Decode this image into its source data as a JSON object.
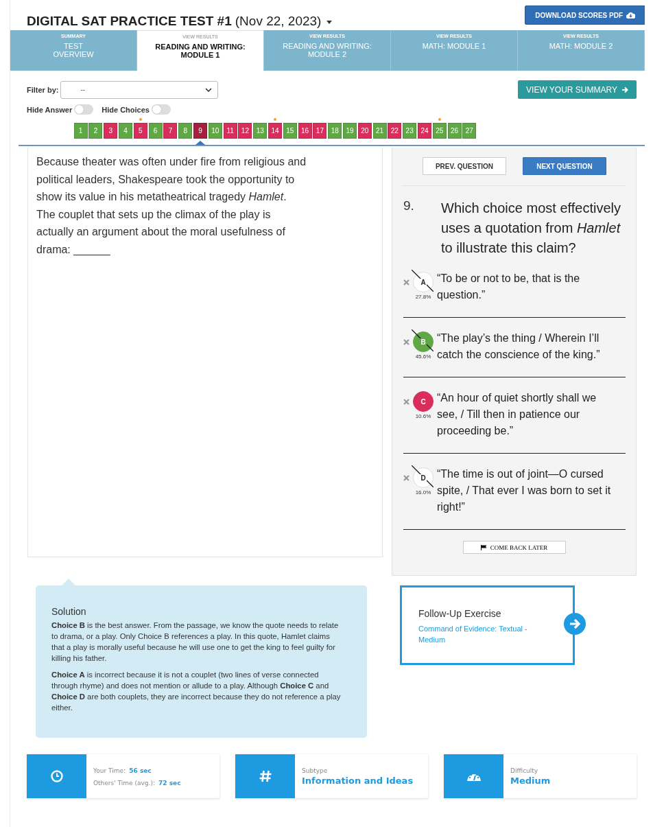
{
  "header": {
    "title": "DIGITAL SAT PRACTICE TEST #1",
    "date": "(Nov 22, 2023)",
    "download_button": "DOWNLOAD SCORES PDF"
  },
  "tabs": [
    {
      "kicker": "SUMMARY",
      "label": "TEST\nOVERVIEW",
      "selected": false
    },
    {
      "kicker": "VIEW RESULTS",
      "label": "READING AND WRITING:\nMODULE 1",
      "selected": true
    },
    {
      "kicker": "VIEW RESULTS",
      "label": "READING AND WRITING:\nMODULE 2",
      "selected": false
    },
    {
      "kicker": "VIEW RESULTS",
      "label": "MATH: MODULE 1",
      "selected": false
    },
    {
      "kicker": "VIEW RESULTS",
      "label": "MATH: MODULE 2",
      "selected": false
    }
  ],
  "filter": {
    "label": "Filter by:",
    "value": "--"
  },
  "summary_button": "VIEW YOUR SUMMARY",
  "toggles": [
    {
      "label": "Hide Answer",
      "on": false
    },
    {
      "label": "Hide Choices",
      "on": false
    }
  ],
  "questions": [
    {
      "number": "1",
      "correct": true,
      "flagged": false,
      "selected": false
    },
    {
      "number": "2",
      "correct": true,
      "flagged": false,
      "selected": false
    },
    {
      "number": "3",
      "correct": false,
      "flagged": false,
      "selected": false
    },
    {
      "number": "4",
      "correct": true,
      "flagged": false,
      "selected": false
    },
    {
      "number": "5",
      "correct": false,
      "flagged": true,
      "selected": false
    },
    {
      "number": "6",
      "correct": true,
      "flagged": false,
      "selected": false
    },
    {
      "number": "7",
      "correct": false,
      "flagged": false,
      "selected": false
    },
    {
      "number": "8",
      "correct": true,
      "flagged": false,
      "selected": false
    },
    {
      "number": "9",
      "correct": false,
      "flagged": false,
      "selected": true
    },
    {
      "number": "10",
      "correct": true,
      "flagged": false,
      "selected": false
    },
    {
      "number": "11",
      "correct": false,
      "flagged": false,
      "selected": false
    },
    {
      "number": "12",
      "correct": false,
      "flagged": false,
      "selected": false
    },
    {
      "number": "13",
      "correct": true,
      "flagged": false,
      "selected": false
    },
    {
      "number": "14",
      "correct": false,
      "flagged": true,
      "selected": false
    },
    {
      "number": "15",
      "correct": true,
      "flagged": false,
      "selected": false
    },
    {
      "number": "16",
      "correct": false,
      "flagged": false,
      "selected": false
    },
    {
      "number": "17",
      "correct": false,
      "flagged": false,
      "selected": false
    },
    {
      "number": "18",
      "correct": true,
      "flagged": false,
      "selected": false
    },
    {
      "number": "19",
      "correct": true,
      "flagged": false,
      "selected": false
    },
    {
      "number": "20",
      "correct": false,
      "flagged": false,
      "selected": false
    },
    {
      "number": "21",
      "correct": true,
      "flagged": false,
      "selected": false
    },
    {
      "number": "22",
      "correct": false,
      "flagged": false,
      "selected": false
    },
    {
      "number": "23",
      "correct": true,
      "flagged": false,
      "selected": false
    },
    {
      "number": "24",
      "correct": false,
      "flagged": false,
      "selected": false
    },
    {
      "number": "25",
      "correct": true,
      "flagged": true,
      "selected": false
    },
    {
      "number": "26",
      "correct": true,
      "flagged": false,
      "selected": false
    },
    {
      "number": "27",
      "correct": true,
      "flagged": false,
      "selected": false
    }
  ],
  "passage": {
    "text": "Because theater was often under fire from religious and political leaders, Shakespeare took the opportunity to show its value in his metatheatrical tragedy *Hamlet*. The couplet that sets up the climax of the play is actually an argument about the moral usefulness of drama: ______"
  },
  "question_panel": {
    "prev_button": "PREV. QUESTION",
    "next_button": "NEXT QUESTION",
    "number": "9.",
    "prompt": "Which choice most effectively uses a quotation from *Hamlet* to illustrate this claim?",
    "choices": [
      {
        "letter": "A",
        "text": "“To be or not to be, that is the question.”",
        "percent": "27.8%",
        "correct_answer": false,
        "chosen": false,
        "crossed_out": true
      },
      {
        "letter": "B",
        "text": "“The play’s the thing / Wherein I’ll catch the conscience of the king.”",
        "percent": "45.6%",
        "correct_answer": true,
        "chosen": false,
        "crossed_out": true
      },
      {
        "letter": "C",
        "text": "“An hour of quiet shortly shall we see, / Till then in patience our proceeding be.”",
        "percent": "10.6%",
        "correct_answer": false,
        "chosen": true,
        "crossed_out": false
      },
      {
        "letter": "D",
        "text": "“The time is out of joint—O cursed spite, / That ever I was born to set it right!”",
        "percent": "16.0%",
        "correct_answer": false,
        "chosen": false,
        "crossed_out": true
      }
    ],
    "later_button": "COME BACK LATER"
  },
  "solution": {
    "title": "Solution",
    "paragraphs": [
      "**Choice B** is the best answer. From the passage, we know the quote needs to relate to drama, or a play. Only Choice B references a play. In this quote, Hamlet claims that a play is morally useful because he will use one to get the king to feel guilty for killing his father.",
      "**Choice A** is incorrect because it is not a couplet (two lines of verse connected through rhyme) and does not mention or allude to a play. Although **Choice C** and **Choice D** are both couplets, they are incorrect because they do not reference a play either."
    ]
  },
  "follow_up": {
    "title": "Follow-Up Exercise",
    "link": "Command of Evidence: Textual - Medium"
  },
  "stats": [
    {
      "kind": "time",
      "rows": [
        {
          "label": "Your Time:",
          "value": "56 sec"
        },
        {
          "label": "Others' Time (avg.):",
          "value": "72 sec"
        }
      ]
    },
    {
      "kind": "subtype",
      "label": "Subtype",
      "value": "Information and Ideas"
    },
    {
      "kind": "difficulty",
      "label": "Difficulty",
      "value": "Medium"
    }
  ]
}
